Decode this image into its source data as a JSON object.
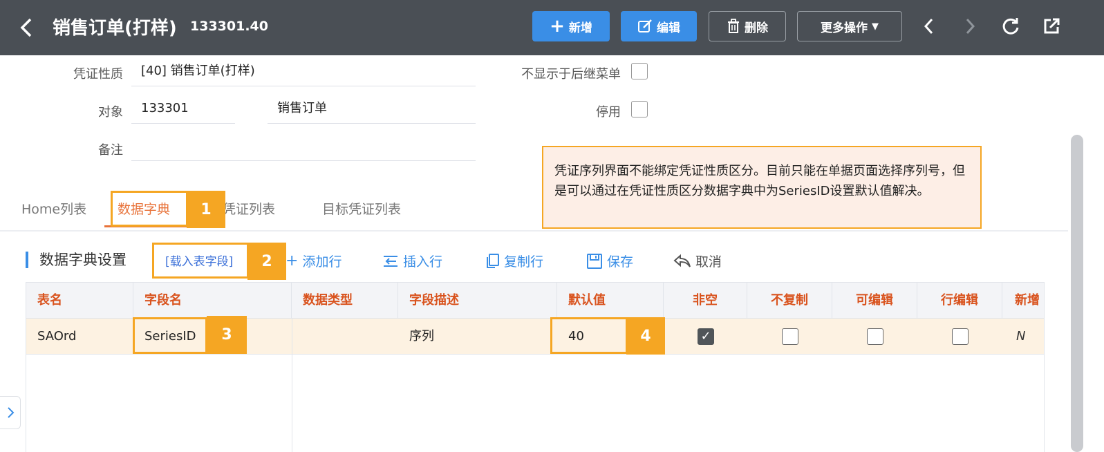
{
  "header": {
    "title": "销售订单(打样)",
    "subtitle": "133301.40",
    "buttons": {
      "add": "新增",
      "edit": "编辑",
      "delete": "删除",
      "more": "更多操作"
    }
  },
  "form": {
    "voucher_type_label": "凭证性质",
    "voucher_type_value": "[40] 销售订单(打样)",
    "object_label": "对象",
    "object_code": "133301",
    "object_name": "销售订单",
    "remark_label": "备注",
    "hide_label": "不显示于后继菜单",
    "disabled_label": "停用"
  },
  "note": "凭证序列界面不能绑定凭证性质区分。目前只能在单据页面选择序列号，但是可以通过在凭证性质区分数据字典中为SeriesID设置默认值解决。",
  "tabs": [
    "Home列表",
    "数据字典",
    "出凭证列表",
    "目标凭证列表"
  ],
  "markers": [
    "1",
    "2",
    "3",
    "4"
  ],
  "toolbar": {
    "section_title": "数据字典设置",
    "load_fields": "[载入表字段]",
    "add_row": "添加行",
    "insert_row": "插入行",
    "copy_row": "复制行",
    "save": "保存",
    "cancel": "取消"
  },
  "table": {
    "columns": [
      "表名",
      "字段名",
      "数据类型",
      "字段描述",
      "默认值",
      "非空",
      "不复制",
      "可编辑",
      "行编辑",
      "新增"
    ],
    "rows": [
      {
        "table_name": "SAOrd",
        "field_name": "SeriesID",
        "data_type": "",
        "description": "序列",
        "default_value": "40",
        "not_null": true,
        "no_copy": false,
        "editable": false,
        "row_edit": false,
        "new_fragment": "N"
      }
    ]
  },
  "colors": {
    "header_bg": "#4a4f55",
    "primary": "#3a8ee6",
    "accent_orange": "#f5a623",
    "tab_active": "#e8733a",
    "column_header": "#d9531e",
    "row_highlight": "#fdf2e2"
  },
  "icons": {
    "back": "back-arrow-icon",
    "add": "plus-icon",
    "edit": "edit-icon",
    "delete": "trash-icon",
    "more": "caret-down-icon",
    "prev": "chevron-left-icon",
    "next": "chevron-right-icon",
    "refresh": "refresh-icon",
    "open": "external-open-icon"
  }
}
